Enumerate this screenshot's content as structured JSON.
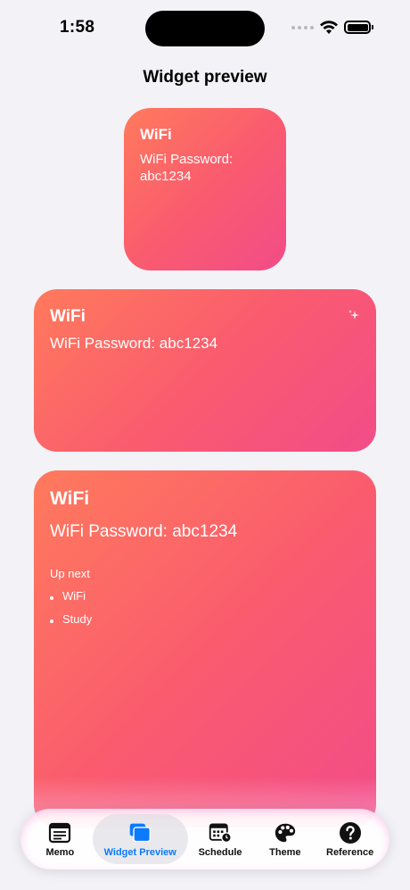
{
  "status_bar": {
    "time": "1:58"
  },
  "page": {
    "title": "Widget preview"
  },
  "widgets": {
    "small": {
      "title": "WiFi",
      "body": "WiFi Password: abc1234"
    },
    "medium": {
      "title": "WiFi",
      "body": "WiFi Password: abc1234"
    },
    "large": {
      "title": "WiFi",
      "body": "WiFi Password: abc1234",
      "up_next_label": "Up next",
      "up_next_items": [
        "WiFi",
        "Study"
      ]
    },
    "gradient_colors": [
      "#ff7a5c",
      "#fa5c6e",
      "#f24c88"
    ]
  },
  "tab_bar": {
    "active_color": "#0a7aff",
    "tabs": [
      {
        "label": "Memo",
        "icon": "memo-icon"
      },
      {
        "label": "Widget Preview",
        "icon": "widget-preview-icon",
        "active": true
      },
      {
        "label": "Schedule",
        "icon": "schedule-icon"
      },
      {
        "label": "Theme",
        "icon": "palette-icon"
      },
      {
        "label": "Reference",
        "icon": "question-icon"
      }
    ]
  }
}
